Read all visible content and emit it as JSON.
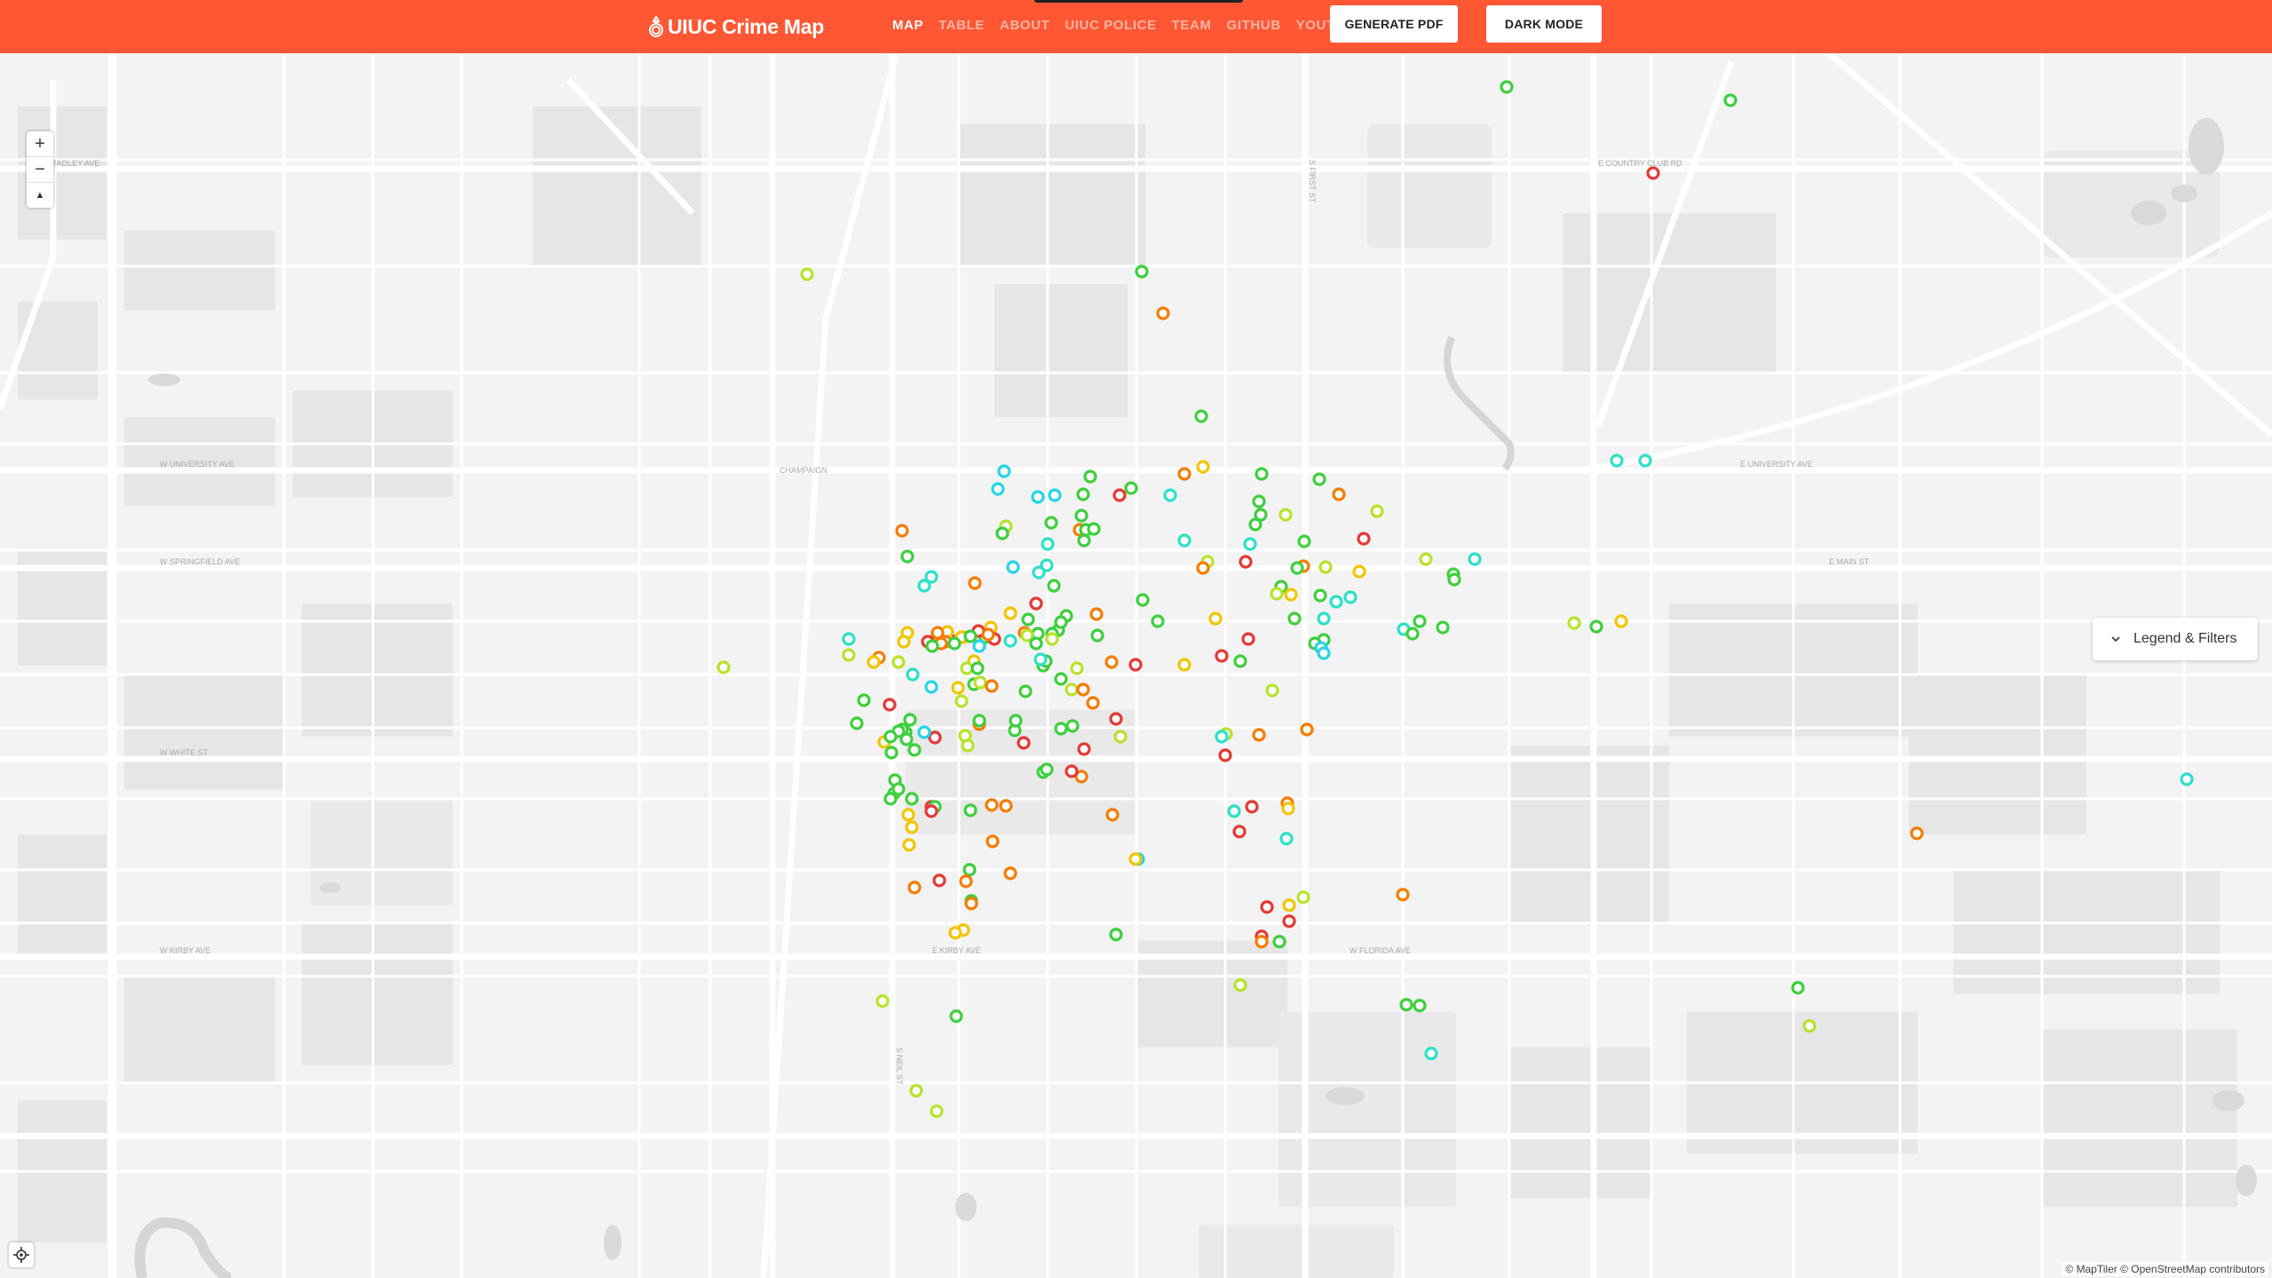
{
  "app": {
    "title": "UIUC Crime Map"
  },
  "nav": {
    "items": [
      "MAP",
      "TABLE",
      "ABOUT",
      "UIUC POLICE",
      "TEAM",
      "GITHUB",
      "YOUTUBE"
    ],
    "active": "MAP"
  },
  "buttons": {
    "pdf_label": "GENERATE PDF",
    "dark_label": "DARK MODE"
  },
  "map_controls": {
    "zoom_in": "+",
    "zoom_out": "−",
    "compass": "▲"
  },
  "legend": {
    "label": "Legend & Filters"
  },
  "attribution": "© MapTiler © OpenStreetMap contributors",
  "map_labels": {
    "city": "CHAMPAIGN",
    "streets": [
      "W UNIVERSITY AVE",
      "W SPRINGFIELD AVE",
      "W WHITE ST",
      "E UNIVERSITY AVE",
      "W FLORIDA AVE",
      "E KIRBY AVE",
      "W KIRBY AVE",
      "E MAIN ST",
      "S NEIL ST",
      "S FIRST ST",
      "E COUNTRY CLUB RD",
      "W BRADLEY AVE"
    ]
  },
  "marker_colors": {
    "red": "#e53935",
    "orange": "#f57c00",
    "yellow": "#f2c500",
    "yellowgreen": "#b6e32b",
    "green": "#3ecf3e",
    "teal": "#2de0c8",
    "cyan": "#27d4e8"
  }
}
